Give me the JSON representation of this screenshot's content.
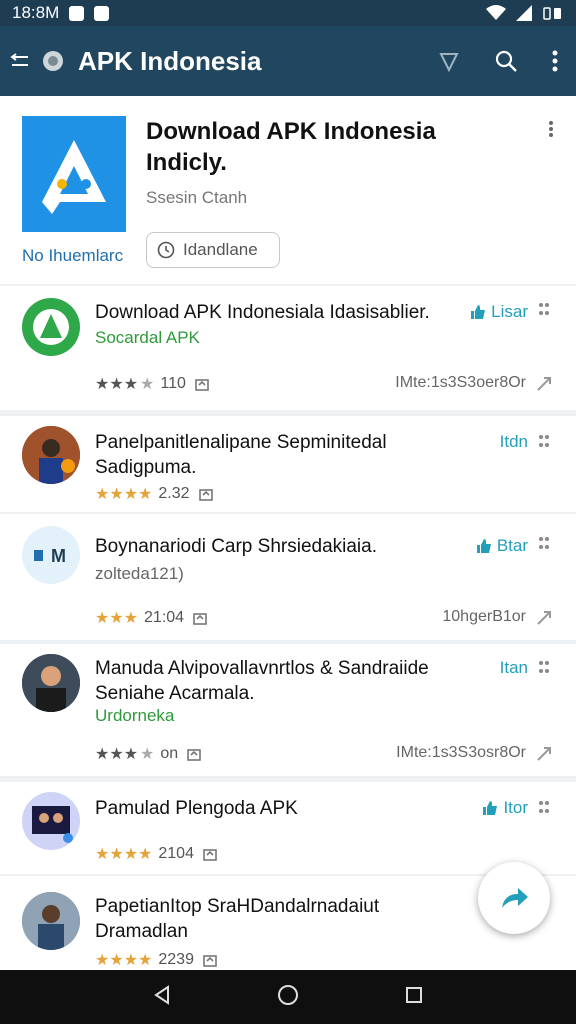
{
  "status_bar": {
    "time": "18:8M"
  },
  "app_bar": {
    "title": "APK Indonesia"
  },
  "hero": {
    "title": "Download APK Indonesia Indicly.",
    "developer": "Ssesin Ctanh",
    "logo_caption": "No Ihuemlarc",
    "install_label": "Idandlane"
  },
  "items": [
    {
      "title": "Download APK Indonesiala Idasisablier.",
      "subtitle": "Socardal APK",
      "rating": "110",
      "right_label": "Lisar",
      "right_meta": "IMte:1s3S3oer8Or"
    },
    {
      "title": "Panelpanitlenalipane Sepminitedal Sadigpuma.",
      "rating": "2.32",
      "right_label": "Itdn"
    },
    {
      "title": "Boynanariodi Carp Shrsiedakiaia.",
      "subtitle": "zolteda121)",
      "rating": "21:04",
      "right_label": "Btar",
      "right_meta": "10hgerB1or"
    },
    {
      "title": "Manuda Alvipovallavnrtlos & Sandraiide Seniahe Acarmala.",
      "subtitle": "Urdorneka",
      "rating": "on",
      "right_label": "Itan",
      "right_meta": "IMte:1s3S3osr8Or"
    },
    {
      "title": "Pamulad Plengoda APK",
      "rating": "2104",
      "right_label": "Itor"
    },
    {
      "title": "PapetianItop SraHDandalrnadaiut Dramadlan",
      "rating": "2239"
    }
  ],
  "colors": {
    "app_bar": "#21465f",
    "status_bar": "#1e3d53",
    "accent": "#22a0b9",
    "green": "#2f9a3a",
    "star_gold": "#e6a33a",
    "logo_blue": "#1f92e6"
  },
  "icons": [
    "menu-back-icon",
    "globe-icon",
    "filter-icon",
    "search-icon",
    "overflow-menu-icon",
    "thumb-up-icon",
    "share-icon",
    "back-nav-icon",
    "home-nav-icon",
    "recents-nav-icon"
  ]
}
